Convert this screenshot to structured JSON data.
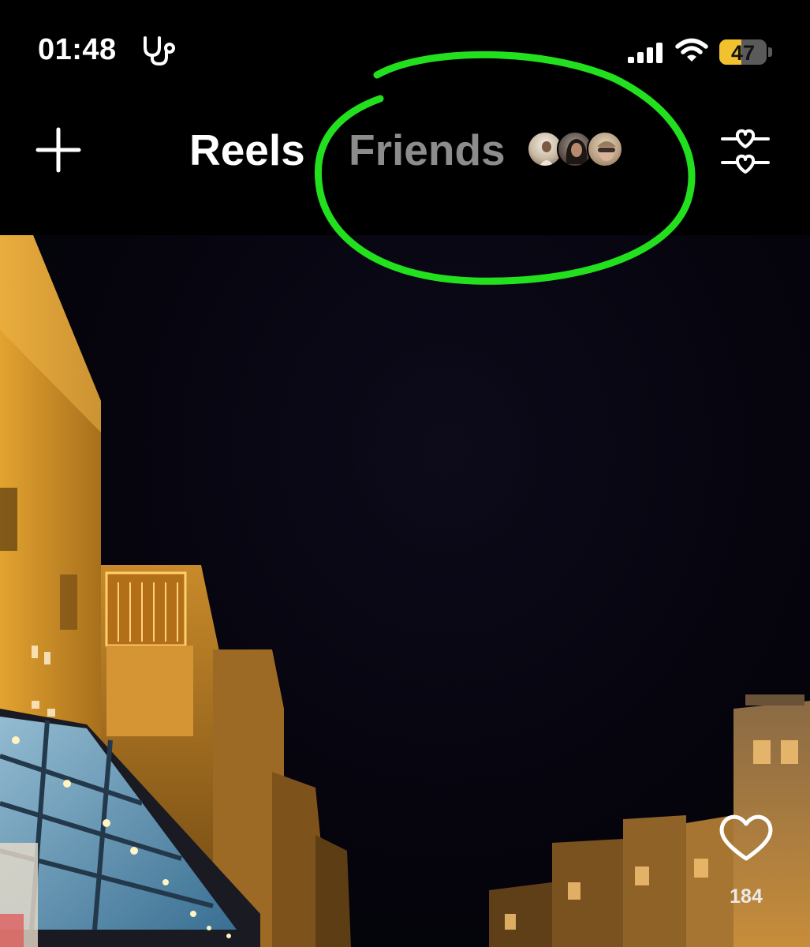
{
  "status_bar": {
    "time": "01:48",
    "health_icon": "stethoscope-icon",
    "signal_icon": "cellular-signal-icon",
    "wifi_icon": "wifi-icon",
    "battery_level": 47,
    "battery_text": "47",
    "battery_color": "#f2c12e"
  },
  "header": {
    "create_icon": "plus-icon",
    "tabs": [
      {
        "label": "Reels",
        "active": true
      },
      {
        "label": "Friends",
        "active": false
      }
    ],
    "friend_avatars": [
      "friend-avatar-1",
      "friend-avatar-2",
      "friend-avatar-3"
    ],
    "filter_icon": "heart-sliders-icon"
  },
  "reel": {
    "like_icon": "heart-outline-icon",
    "like_count": "184"
  },
  "annotation": {
    "type": "hand-drawn-circle",
    "color": "#22e01e",
    "target": "Friends"
  }
}
